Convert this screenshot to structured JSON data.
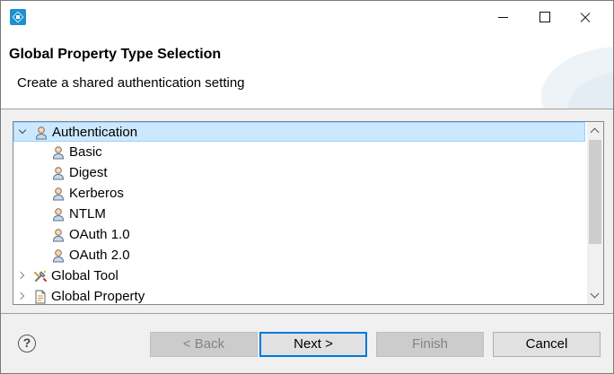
{
  "dialog": {
    "title": "Global Property Type Selection",
    "description": "Create a shared authentication setting"
  },
  "tree": {
    "items": [
      {
        "label": "Authentication",
        "icon": "user-icon",
        "expanded": true,
        "selected": true
      },
      {
        "label": "Basic",
        "icon": "user-icon"
      },
      {
        "label": "Digest",
        "icon": "user-icon"
      },
      {
        "label": "Kerberos",
        "icon": "user-icon"
      },
      {
        "label": "NTLM",
        "icon": "user-icon"
      },
      {
        "label": "OAuth 1.0",
        "icon": "user-icon"
      },
      {
        "label": "OAuth 2.0",
        "icon": "user-icon"
      },
      {
        "label": "Global Tool",
        "icon": "tool-icon",
        "expanded": false
      },
      {
        "label": "Global Property",
        "icon": "property-icon",
        "expanded": false
      }
    ]
  },
  "buttons": {
    "help": "?",
    "back": "< Back",
    "next": "Next >",
    "finish": "Finish",
    "cancel": "Cancel"
  },
  "colors": {
    "selection": "#cce8ff",
    "accent": "#0078d7"
  }
}
